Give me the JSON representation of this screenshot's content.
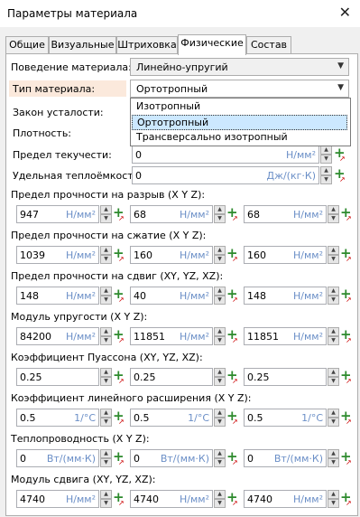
{
  "window": {
    "title": "Параметры материала"
  },
  "tabs": [
    "Общие",
    "Визуальные",
    "Штриховка",
    "Физические",
    "Состав"
  ],
  "behavior": {
    "label": "Поведение материала:",
    "value": "Линейно-упругий"
  },
  "type": {
    "label": "Тип материала:",
    "value": "Ортотропный",
    "options": [
      "Изотропный",
      "Ортотропный",
      "Трансверсально изотропный"
    ]
  },
  "fatigue": {
    "label": "Закон усталости:"
  },
  "density": {
    "label": "Плотность:"
  },
  "yield": {
    "label": "Предел текучести:",
    "value": "0",
    "unit": "Н/мм²"
  },
  "heat": {
    "label": "Удельная теплоёмкость:",
    "value": "0",
    "unit": "Дж/(кг·К)"
  },
  "groups": [
    {
      "label": "Предел прочности на разрыв (X Y Z):",
      "unit": "Н/мм²",
      "values": [
        "947",
        "68",
        "68"
      ]
    },
    {
      "label": "Предел прочности на сжатие (X Y Z):",
      "unit": "Н/мм²",
      "values": [
        "1039",
        "160",
        "160"
      ]
    },
    {
      "label": "Предел прочности на сдвиг (XY, YZ, XZ):",
      "unit": "Н/мм²",
      "values": [
        "148",
        "40",
        "148"
      ]
    },
    {
      "label": "Модуль упругости (X Y Z):",
      "unit": "Н/мм²",
      "values": [
        "84200",
        "11851",
        "11851"
      ]
    },
    {
      "label": "Коэффициент Пуассона (XY, YZ, XZ):",
      "unit": "",
      "values": [
        "0.25",
        "0.25",
        "0.25"
      ]
    },
    {
      "label": "Коэффициент линейного расширения (X Y Z):",
      "unit": "1/°C",
      "values": [
        "0.5",
        "0.5",
        "0.5"
      ]
    },
    {
      "label": "Теплопроводность (X Y Z):",
      "unit": "Вт/(мм·К)",
      "values": [
        "0",
        "0",
        "0"
      ]
    },
    {
      "label": "Модуль сдвига (XY, YZ, XZ):",
      "unit": "Н/мм²",
      "values": [
        "4740",
        "4740",
        "4740"
      ]
    }
  ]
}
